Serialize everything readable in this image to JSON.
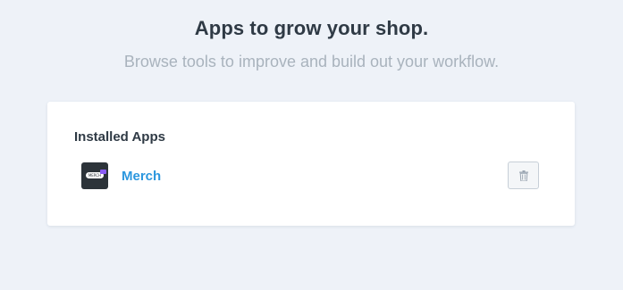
{
  "hero": {
    "title": "Apps to grow your shop.",
    "subtitle": "Browse tools to improve and build out your workflow."
  },
  "installed": {
    "heading": "Installed Apps",
    "apps": [
      {
        "name": "Merch",
        "icon": "merch-logo",
        "icon_text": "MERCH",
        "action_icon": "trash-icon"
      }
    ]
  },
  "colors": {
    "background": "#eef2f8",
    "link": "#2c97de",
    "heading": "#2f3a45",
    "muted": "#a9b3bd"
  }
}
